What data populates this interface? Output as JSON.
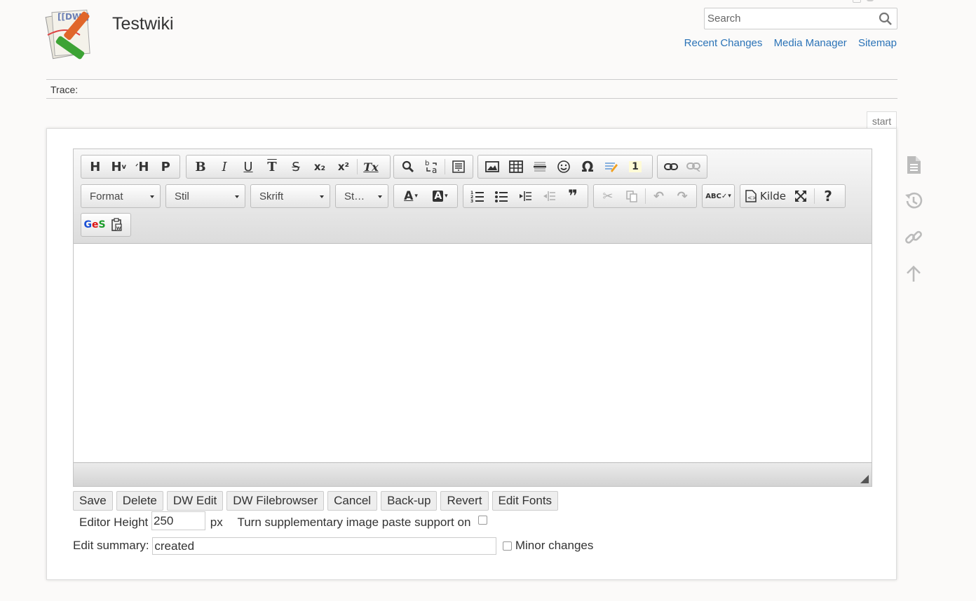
{
  "site": {
    "title": "Testwiki",
    "logo_text": "[[DW]]"
  },
  "search": {
    "placeholder": "Search",
    "value": ""
  },
  "top_links": [
    "Recent Changes",
    "Media Manager",
    "Sitemap"
  ],
  "trace": {
    "label": "Trace:"
  },
  "page_id": "start",
  "toolbar": {
    "row1": {
      "headings": [
        "H",
        "H",
        "H",
        "P"
      ],
      "format": [
        "B",
        "I",
        "U",
        "T",
        "S",
        "x₂",
        "x²",
        "Tx"
      ],
      "insert_footnote": "1"
    },
    "combos": {
      "format": "Format",
      "style": "Stil",
      "font": "Skrift",
      "size": "St…"
    },
    "source_label": "Kilde",
    "help": "?",
    "ges": "GeS"
  },
  "form": {
    "buttons": [
      "Save",
      "Delete",
      "DW Edit",
      "DW Filebrowser",
      "Cancel",
      "Back-up",
      "Revert",
      "Edit Fonts"
    ],
    "editor_height_label": "Editor Height",
    "editor_height_value": "250",
    "px_label": "px",
    "image_paste_label": "Turn supplementary image paste support on",
    "summary_label": "Edit summary:",
    "summary_value": "created",
    "minor_label": "Minor changes"
  },
  "pagetools": [
    "show-page-icon",
    "old-revisions-icon",
    "backlinks-icon",
    "back-to-top-icon"
  ]
}
